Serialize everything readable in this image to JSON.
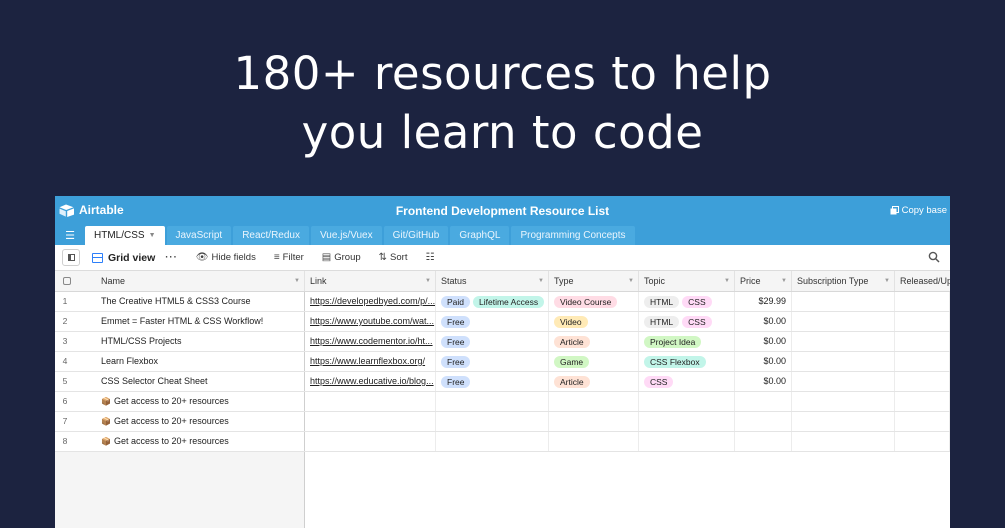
{
  "headline": {
    "line1": "180+ resources to help",
    "line2": "you learn to code"
  },
  "app": {
    "logo_text": "Airtable",
    "base_title": "Frontend Development Resource List",
    "copy_base": "Copy base",
    "tabs": [
      {
        "label": "HTML/CSS",
        "active": true
      },
      {
        "label": "JavaScript"
      },
      {
        "label": "React/Redux"
      },
      {
        "label": "Vue.js/Vuex"
      },
      {
        "label": "Git/GitHub"
      },
      {
        "label": "GraphQL"
      },
      {
        "label": "Programming Concepts"
      }
    ],
    "toolbar": {
      "view": "Grid view",
      "hide_fields": "Hide fields",
      "filter": "Filter",
      "group": "Group",
      "sort": "Sort"
    }
  },
  "columns": {
    "name": "Name",
    "link": "Link",
    "status": "Status",
    "type": "Type",
    "topic": "Topic",
    "price": "Price",
    "subscription": "Subscription Type",
    "released": "Released/Updated"
  },
  "rows": [
    {
      "num": "1",
      "name": "The Creative HTML5 & CSS3 Course",
      "link": "https://developedbyed.com/p/...",
      "status": [
        "Paid",
        "Lifetime Access"
      ],
      "type": "Video Course",
      "topic": [
        "HTML",
        "CSS"
      ],
      "price": "$29.99"
    },
    {
      "num": "2",
      "name": "Emmet = Faster HTML & CSS Workflow!",
      "link": "https://www.youtube.com/wat...",
      "status": [
        "Free"
      ],
      "type": "Video",
      "topic": [
        "HTML",
        "CSS"
      ],
      "price": "$0.00"
    },
    {
      "num": "3",
      "name": "HTML/CSS Projects",
      "link": "https://www.codementor.io/ht...",
      "status": [
        "Free"
      ],
      "type": "Article",
      "topic": [
        "Project Idea"
      ],
      "price": "$0.00"
    },
    {
      "num": "4",
      "name": "Learn Flexbox",
      "link": "https://www.learnflexbox.org/",
      "status": [
        "Free"
      ],
      "type": "Game",
      "topic": [
        "CSS Flexbox"
      ],
      "price": "$0.00"
    },
    {
      "num": "5",
      "name": "CSS Selector Cheat Sheet",
      "link": "https://www.educative.io/blog...",
      "status": [
        "Free"
      ],
      "type": "Article",
      "topic": [
        "CSS"
      ],
      "price": "$0.00"
    },
    {
      "num": "6",
      "name": "Get access to 20+ resources",
      "locked": true
    },
    {
      "num": "7",
      "name": "Get access to 20+ resources",
      "locked": true
    },
    {
      "num": "8",
      "name": "Get access to 20+ resources",
      "locked": true
    }
  ],
  "pill_colors": {
    "Paid": "#cfe0fc",
    "Lifetime Access": "#c2f5e9",
    "Free": "#cfe0fc",
    "Video Course": "#ffdce5",
    "Video": "#ffeab6",
    "Article": "#fee2d5",
    "Game": "#d1f7c4",
    "HTML": "#eeeeee",
    "CSS": "#ffdaf6",
    "Project Idea": "#d1f7c4",
    "CSS Flexbox": "#c2f5e9"
  },
  "colors": {
    "background": "#1c2340",
    "accent": "#3d9fd9",
    "brand_blue": "#2d7ff9"
  }
}
